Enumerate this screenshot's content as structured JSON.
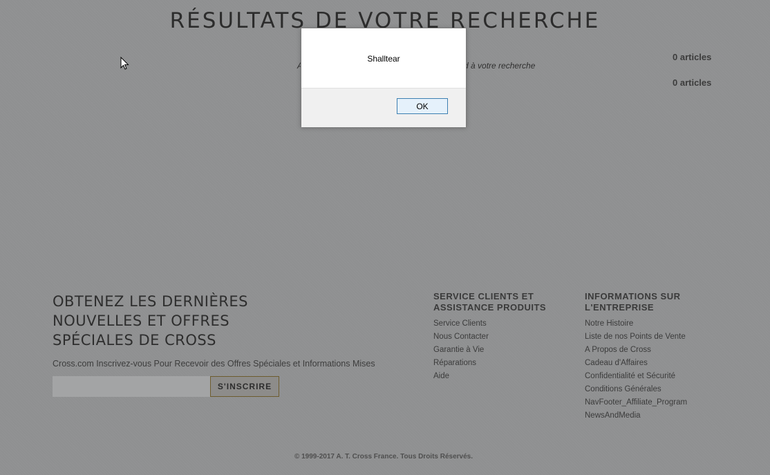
{
  "page": {
    "title": "RÉSULTATS DE VOTRE RECHERCHE",
    "results": [
      {
        "count": "0 articles"
      },
      {
        "count": "0 articles"
      }
    ],
    "message_left_visible": "A",
    "message_right_visible": "d à votre recherche"
  },
  "newsletter": {
    "title": "OBTENEZ LES DERNIÈRES NOUVELLES ET OFFRES SPÉCIALES DE CROSS",
    "text": "Cross.com Inscrivez-vous Pour Recevoir des Offres Spéciales et Informations Mises",
    "input_value": "",
    "subscribe_label": "S'INSCRIRE"
  },
  "footer": {
    "col1": {
      "heading": "SERVICE CLIENTS ET ASSISTANCE PRODUITS",
      "links": [
        "Service Clients",
        "Nous Contacter",
        "Garantie à Vie",
        "Réparations",
        "Aide"
      ]
    },
    "col2": {
      "heading": "INFORMATIONS SUR L'ENTREPRISE",
      "links": [
        "Notre Histoire",
        "Liste de nos Points de Vente",
        "A Propos de Cross",
        "Cadeau d'Affaires",
        "Confidentialité et Sécurité",
        "Conditions Générales",
        "NavFooter_Affiliate_Program",
        "NewsAndMedia"
      ]
    },
    "copyright": "© 1999-2017 A. T. Cross France. Tous Droits Réservés."
  },
  "dialog": {
    "message": "Shalltear",
    "ok_label": "OK"
  },
  "colors": {
    "overlay_bg": "#8f9091",
    "dialog_bg": "#ffffff",
    "dialog_footer_bg": "#f0f0f0",
    "ok_border": "#3c7fb1",
    "subscribe_border": "#6d5c2e"
  },
  "icons": {
    "cursor": "mouse-pointer-icon"
  }
}
